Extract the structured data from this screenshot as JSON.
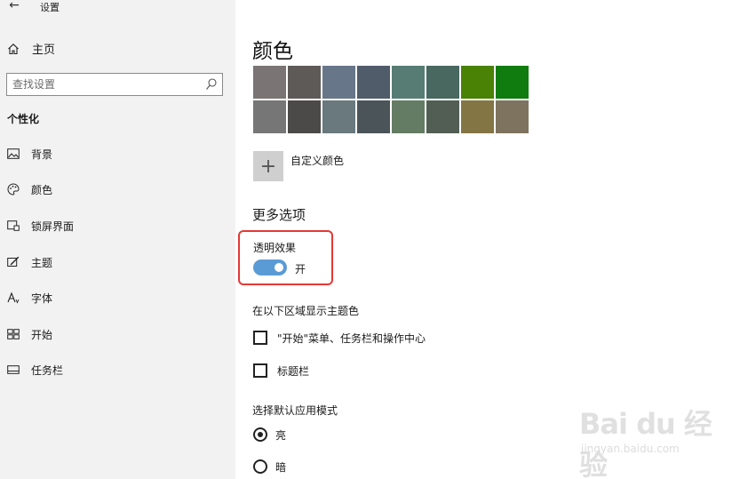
{
  "window": {
    "title": "设置",
    "controls": {
      "minimize": "—",
      "maximize": "☐",
      "close": "✕"
    }
  },
  "sidebar": {
    "back_icon": "←",
    "home_label": "主页",
    "search_placeholder": "查找设置",
    "section_title": "个性化",
    "items": [
      {
        "label": "背景",
        "icon": "picture-icon"
      },
      {
        "label": "颜色",
        "icon": "palette-icon"
      },
      {
        "label": "锁屏界面",
        "icon": "lock-screen-icon"
      },
      {
        "label": "主题",
        "icon": "theme-brush-icon"
      },
      {
        "label": "字体",
        "icon": "font-icon"
      },
      {
        "label": "开始",
        "icon": "start-grid-icon"
      },
      {
        "label": "任务栏",
        "icon": "taskbar-icon"
      }
    ]
  },
  "main": {
    "title": "颜色",
    "swatches": [
      "#7a7574",
      "#5d5a58",
      "#68768a",
      "#515c6b",
      "#567c73",
      "#486860",
      "#498205",
      "#107c10",
      "#767676",
      "#4c4a48",
      "#69797e",
      "#4a5459",
      "#647c64",
      "#525e54",
      "#847545",
      "#7e735f"
    ],
    "custom_color_label": "自定义颜色",
    "custom_color_icon": "+",
    "more_options_heading": "更多选项",
    "transparency_label": "透明效果",
    "transparency_state": "开",
    "accent_heading": "在以下区域显示主题色",
    "accent_checkboxes": [
      {
        "label": "\"开始\"菜单、任务栏和操作中心",
        "checked": false
      },
      {
        "label": "标题栏",
        "checked": false
      }
    ],
    "mode_heading": "选择默认应用模式",
    "mode_options": [
      {
        "label": "亮",
        "selected": true
      },
      {
        "label": "暗",
        "selected": false
      }
    ]
  },
  "watermark": {
    "logo": "Bai du 经验",
    "sub": "jingyan.baidu.com"
  },
  "colors": {
    "toggle_on": "#5b9bd5",
    "highlight_border": "#e53935",
    "sidebar_bg": "#f2f2f2"
  }
}
